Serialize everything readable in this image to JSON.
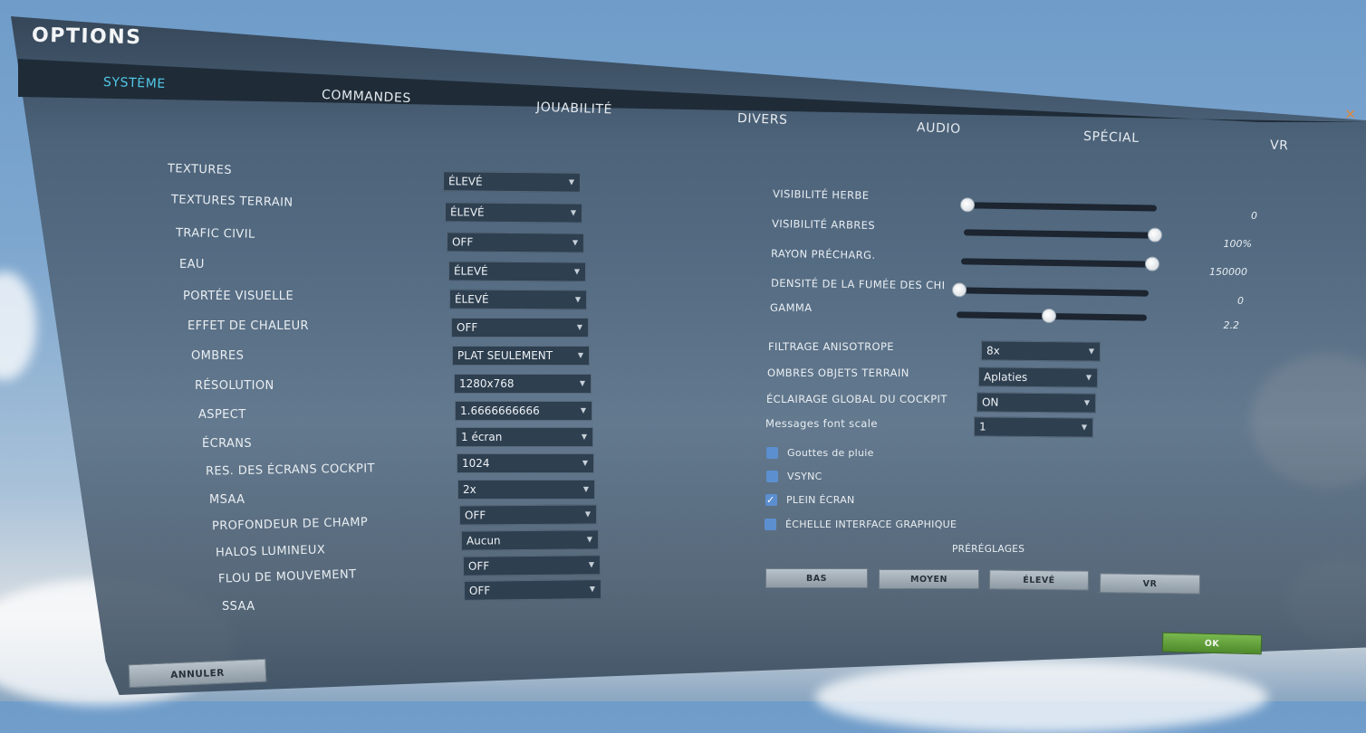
{
  "window": {
    "title": "OPTIONS",
    "close_glyph": "×"
  },
  "tabs": [
    {
      "label": "SYSTÈME",
      "active": true
    },
    {
      "label": "COMMANDES"
    },
    {
      "label": "JOUABILITÉ"
    },
    {
      "label": "DIVERS"
    },
    {
      "label": "AUDIO"
    },
    {
      "label": "SPÉCIAL"
    },
    {
      "label": "VR"
    }
  ],
  "left_settings": [
    {
      "label": "TEXTURES",
      "value": "ÉLEVÉ"
    },
    {
      "label": "TEXTURES TERRAIN",
      "value": "ÉLEVÉ"
    },
    {
      "label": "TRAFIC CIVIL",
      "value": "OFF"
    },
    {
      "label": "EAU",
      "value": "ÉLEVÉ"
    },
    {
      "label": "PORTÉE VISUELLE",
      "value": "ÉLEVÉ"
    },
    {
      "label": "EFFET DE CHALEUR",
      "value": "OFF"
    },
    {
      "label": "OMBRES",
      "value": "PLAT SEULEMENT"
    },
    {
      "label": "RÉSOLUTION",
      "value": "1280x768"
    },
    {
      "label": "ASPECT",
      "value": "1.6666666666"
    },
    {
      "label": "ÉCRANS",
      "value": "1 écran"
    },
    {
      "label": "RES. DES ÉCRANS COCKPIT",
      "value": "1024"
    },
    {
      "label": "MSAA",
      "value": "2x"
    },
    {
      "label": "PROFONDEUR DE CHAMP",
      "value": "OFF"
    },
    {
      "label": "HALOS LUMINEUX",
      "value": "Aucun"
    },
    {
      "label": "FLOU DE MOUVEMENT",
      "value": "OFF"
    },
    {
      "label": "SSAA",
      "value": "OFF"
    }
  ],
  "sliders": [
    {
      "label": "VISIBILITÉ HERBE",
      "value": "0",
      "level": 0.0
    },
    {
      "label": "VISIBILITÉ ARBRES",
      "value": "100%",
      "level": 1.0
    },
    {
      "label": "RAYON PRÉCHARG.",
      "value": "150000",
      "level": 1.0
    },
    {
      "label": "DENSITÉ DE LA FUMÉE DES CHI",
      "value": "0",
      "level": 0.0
    },
    {
      "label": "GAMMA",
      "value": "2.2",
      "level": 0.48
    }
  ],
  "right_selects": [
    {
      "label": "FILTRAGE ANISOTROPE",
      "value": "8x"
    },
    {
      "label": "OMBRES OBJETS TERRAIN",
      "value": "Aplaties"
    },
    {
      "label": "ÉCLAIRAGE GLOBAL DU COCKPIT",
      "value": "ON"
    },
    {
      "label": "Messages font scale",
      "value": "1"
    }
  ],
  "checkboxes": [
    {
      "label": "Gouttes de pluie",
      "checked": false
    },
    {
      "label": "VSYNC",
      "checked": false
    },
    {
      "label": "PLEIN ÉCRAN",
      "checked": true
    },
    {
      "label": "ÉCHELLE INTERFACE GRAPHIQUE",
      "checked": false
    }
  ],
  "presets": {
    "title": "PRÉRÉGLAGES",
    "buttons": [
      "BAS",
      "MOYEN",
      "ÉLEVÉ",
      "VR"
    ]
  },
  "footer": {
    "cancel_label": "ANNULER",
    "ok_label": "OK"
  },
  "icons": {
    "dropdown_arrow": "▼",
    "check": "✓"
  },
  "colors": {
    "active_tab": "#52c7e6",
    "ok_button": "#5e9c38",
    "close": "#e0883a",
    "checkbox": "#5b8fd0"
  }
}
